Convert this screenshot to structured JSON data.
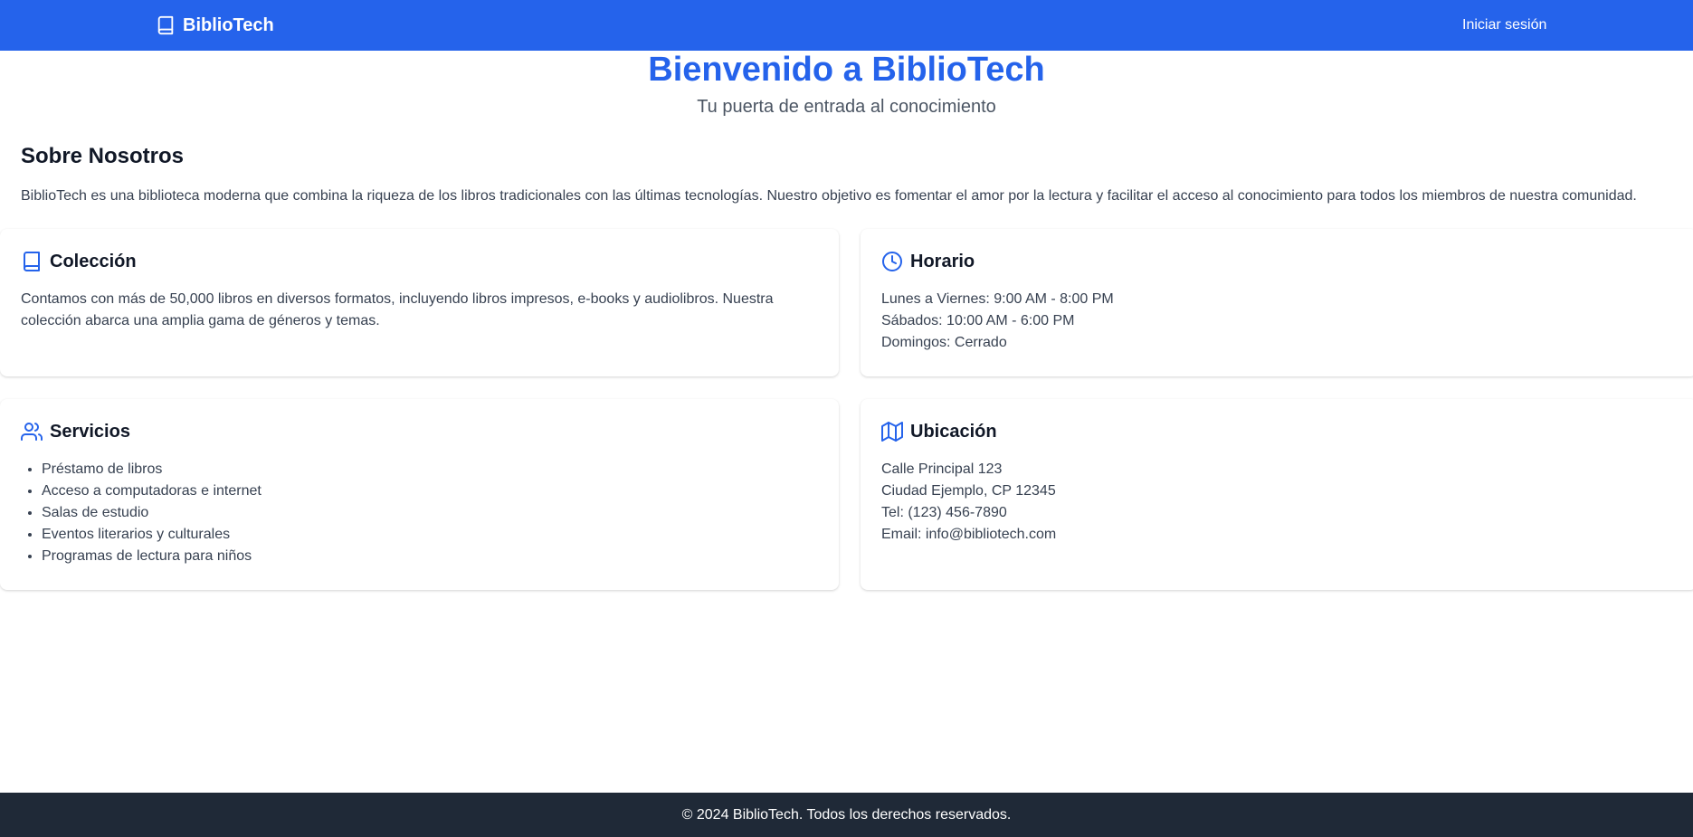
{
  "colors": {
    "primary": "#2563eb",
    "footer_bg": "#1f2937",
    "text_muted": "#374151"
  },
  "navbar": {
    "brand": "BiblioTech",
    "brand_icon": "book-icon",
    "login_label": "Iniciar sesión"
  },
  "hero": {
    "title": "Bienvenido a BiblioTech",
    "subtitle": "Tu puerta de entrada al conocimiento"
  },
  "about": {
    "title": "Sobre Nosotros",
    "text": "BiblioTech es una biblioteca moderna que combina la riqueza de los libros tradicionales con las últimas tecnologías. Nuestro objetivo es fomentar el amor por la lectura y facilitar el acceso al conocimiento para todos los miembros de nuestra comunidad."
  },
  "cards": {
    "coleccion": {
      "title": "Colección",
      "icon": "book-icon",
      "text": "Contamos con más de 50,000 libros en diversos formatos, incluyendo libros impresos, e-books y audiolibros. Nuestra colección abarca una amplia gama de géneros y temas."
    },
    "horario": {
      "title": "Horario",
      "icon": "clock-icon",
      "lines": [
        "Lunes a Viernes: 9:00 AM - 8:00 PM",
        "Sábados: 10:00 AM - 6:00 PM",
        "Domingos: Cerrado"
      ]
    },
    "servicios": {
      "title": "Servicios",
      "icon": "users-icon",
      "items": [
        "Préstamo de libros",
        "Acceso a computadoras e internet",
        "Salas de estudio",
        "Eventos literarios y culturales",
        "Programas de lectura para niños"
      ]
    },
    "ubicacion": {
      "title": "Ubicación",
      "icon": "map-icon",
      "lines": [
        "Calle Principal 123",
        "Ciudad Ejemplo, CP 12345",
        "Tel: (123) 456-7890",
        "Email: info@bibliotech.com"
      ]
    }
  },
  "footer": {
    "text": "© 2024 BiblioTech. Todos los derechos reservados."
  }
}
